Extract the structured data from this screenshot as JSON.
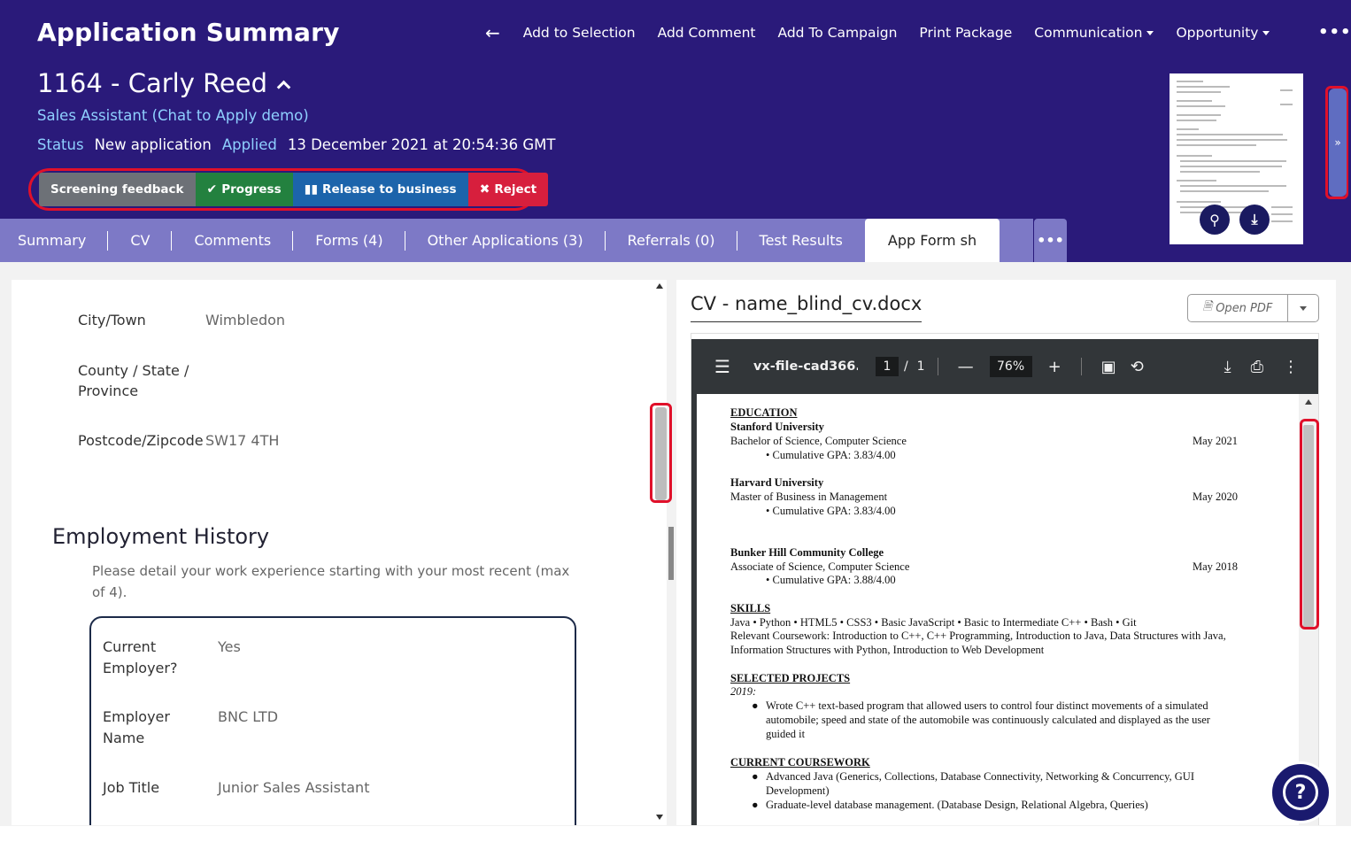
{
  "header": {
    "title": "Application Summary",
    "nav": {
      "back_icon": "arrow-left-icon",
      "add_to_selection": "Add to Selection",
      "add_comment": "Add Comment",
      "add_to_campaign": "Add To Campaign",
      "print_package": "Print Package",
      "communication": "Communication",
      "opportunity": "Opportunity",
      "more": "•••"
    },
    "candidate_name": "1164 - Carly Reed",
    "job_title": "Sales Assistant (Chat to Apply demo)",
    "status": {
      "status_label": "Status",
      "status_value": "New application",
      "applied_label": "Applied",
      "applied_value": "13 December 2021 at 20:54:36 GMT"
    },
    "actions": {
      "screening_feedback": "Screening feedback",
      "progress": "Progress",
      "release_to_business": "Release to business",
      "reject": "Reject"
    },
    "side_toggle": "»"
  },
  "tabs": [
    {
      "label": "Summary"
    },
    {
      "label": "CV"
    },
    {
      "label": "Comments"
    },
    {
      "label": "Forms (4)"
    },
    {
      "label": "Other Applications (3)"
    },
    {
      "label": "Referrals (0)"
    },
    {
      "label": "Test Results"
    },
    {
      "label": "App Form sh",
      "active": true
    }
  ],
  "tab_more": "•••",
  "form": {
    "fields": [
      {
        "label": "City/Town",
        "value": "Wimbledon"
      },
      {
        "label_line1": "County / State /",
        "label_line2": "Province",
        "value": ""
      },
      {
        "label": "Postcode/Zipcode",
        "value": "SW17 4TH"
      }
    ],
    "section_title": "Employment History",
    "section_desc": "Please detail your work experience starting with your most recent (max of 4).",
    "employment": {
      "current_employer_line1": "Current",
      "current_employer_line2": "Employer?",
      "current_employer_value": "Yes",
      "employer_name_line1": "Employer",
      "employer_name_line2": "Name",
      "employer_name_value": "BNC LTD",
      "job_title_label": "Job Title",
      "job_title_value": "Junior Sales Assistant"
    }
  },
  "cv_viewer": {
    "title": "CV - name_blind_cv.docx",
    "open_pdf": "Open PDF",
    "toolbar": {
      "filename": "vx-file-cad366...",
      "page_current": "1",
      "page_sep": "/",
      "page_total": "1",
      "zoom": "76%"
    },
    "document": {
      "education_heading": "EDUCATION",
      "edu1_school": "Stanford University",
      "edu1_degree": "Bachelor of Science, Computer Science",
      "edu1_date": "May 2021",
      "edu1_gpa": "• Cumulative GPA: 3.83/4.00",
      "edu2_school": "Harvard University",
      "edu2_degree": "Master of Business in Management",
      "edu2_date": "May 2020",
      "edu2_gpa": "• Cumulative GPA: 3.83/4.00",
      "edu3_school": "Bunker Hill Community College",
      "edu3_degree": "Associate of Science, Computer Science",
      "edu3_date": "May 2018",
      "edu3_gpa": "• Cumulative GPA: 3.88/4.00",
      "skills_heading": "SKILLS",
      "skills_line1": "Java • Python • HTML5 • CSS3 • Basic JavaScript • Basic to Intermediate C++ • Bash • Git",
      "skills_line2": "Relevant Coursework: Introduction to C++, C++ Programming, Introduction to Java, Data Structures with Java,",
      "skills_line3": "Information Structures with Python, Introduction to Web Development",
      "projects_heading": "SELECTED PROJECTS",
      "projects_year": "2019:",
      "project_line1": "Wrote C++ text-based program that allowed users to control four distinct movements of a simulated",
      "project_line2": "automobile; speed and state of the automobile was continuously calculated and displayed as the user",
      "project_line3": "guided it",
      "coursework_heading": "CURRENT COURSEWORK",
      "course1_line1": "Advanced Java (Generics, Collections, Database Connectivity, Networking & Concurrency, GUI",
      "course1_line2": "Development)",
      "course2": "Graduate-level database management. (Database Design, Relational Algebra, Queries)"
    }
  },
  "help_icon": "question-mark-icon"
}
